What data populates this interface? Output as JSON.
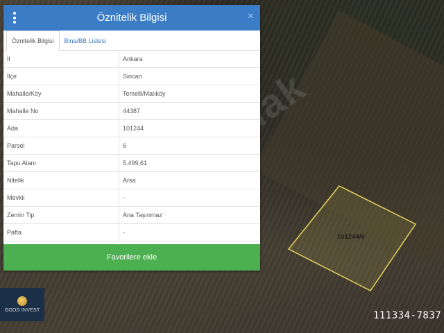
{
  "panel": {
    "title": "Öznitelik Bilgisi",
    "close_label": "×",
    "tabs": [
      {
        "label": "Öznitelik Bilgisi",
        "active": true
      },
      {
        "label": "Bina/BB Listesi",
        "active": false
      }
    ],
    "rows": [
      {
        "key": "İl",
        "value": "Ankara"
      },
      {
        "key": "İlçe",
        "value": "Sincan"
      },
      {
        "key": "Mahalle/Köy",
        "value": "Temelli/Malıköy"
      },
      {
        "key": "Mahalle No",
        "value": "44387"
      },
      {
        "key": "Ada",
        "value": "101244"
      },
      {
        "key": "Parsel",
        "value": "6"
      },
      {
        "key": "Tapu Alanı",
        "value": "5.499,61"
      },
      {
        "key": "Nitelik",
        "value": "Arsa"
      },
      {
        "key": "Mevkii",
        "value": "-"
      },
      {
        "key": "Zemin Tip",
        "value": "Ana Taşınmaz"
      },
      {
        "key": "Pafta",
        "value": "-"
      }
    ],
    "favorites_button": "Favorilere ekle"
  },
  "map": {
    "parcel_label": "101244/6",
    "watermark": "lak"
  },
  "logo": {
    "text": "GOOD INVEST"
  },
  "listing_id": "111334-7837",
  "colors": {
    "header": "#3a7cc5",
    "button": "#4caf50",
    "parcel_outline": "#e6d35a"
  },
  "icons": {
    "menu": "vertical-dots-icon",
    "close": "close-icon"
  }
}
